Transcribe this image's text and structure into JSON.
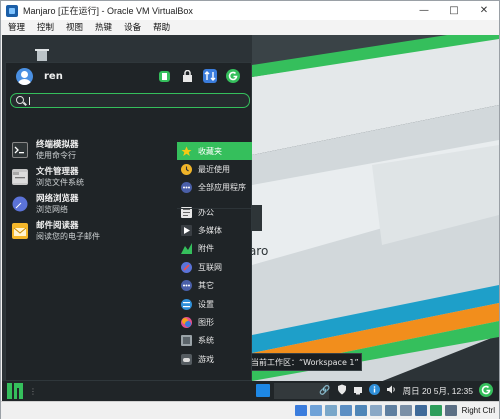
{
  "window": {
    "title": "Manjaro [正在运行] - Oracle VM VirtualBox",
    "controls": [
      "—",
      "□",
      "✕"
    ]
  },
  "menubar": [
    "管理",
    "控制",
    "视图",
    "热键",
    "设备",
    "帮助"
  ],
  "startmenu": {
    "username": "ren",
    "header_icons": [
      "software-center-icon",
      "lock-icon",
      "switch-user-icon",
      "logout-icon"
    ],
    "search_placeholder": "",
    "favorites": [
      {
        "name": "终端模拟器",
        "desc": "使用命令行",
        "icon": "terminal-icon"
      },
      {
        "name": "文件管理器",
        "desc": "浏览文件系统",
        "icon": "file-manager-icon"
      },
      {
        "name": "网络浏览器",
        "desc": "浏览网络",
        "icon": "web-browser-icon"
      },
      {
        "name": "邮件阅读器",
        "desc": "阅读您的电子邮件",
        "icon": "mail-reader-icon"
      }
    ],
    "categories": [
      {
        "label": "收藏夹",
        "icon": "star-icon",
        "selected": true
      },
      {
        "label": "最近使用",
        "icon": "clock-icon"
      },
      {
        "label": "全部应用程序",
        "icon": "dots-icon"
      },
      {
        "label": "办公",
        "icon": "office-icon"
      },
      {
        "label": "多媒体",
        "icon": "multimedia-icon"
      },
      {
        "label": "附件",
        "icon": "accessories-icon"
      },
      {
        "label": "互联网",
        "icon": "internet-icon"
      },
      {
        "label": "其它",
        "icon": "other-icon"
      },
      {
        "label": "设置",
        "icon": "settings-icon"
      },
      {
        "label": "图形",
        "icon": "graphics-icon"
      },
      {
        "label": "系统",
        "icon": "system-icon"
      },
      {
        "label": "游戏",
        "icon": "games-icon"
      }
    ]
  },
  "desktop": {
    "workspace_tooltip": "当前工作区：“Workspace 1”",
    "wallpaper_text": "njaro"
  },
  "panel": {
    "clock": "周日 20 5月, 12:35"
  },
  "statusbar": {
    "host_key": "Right Ctrl"
  },
  "colors": {
    "accent": "#35bf5c",
    "menu_bg": "#1f2427",
    "panel_bg": "#202528"
  }
}
